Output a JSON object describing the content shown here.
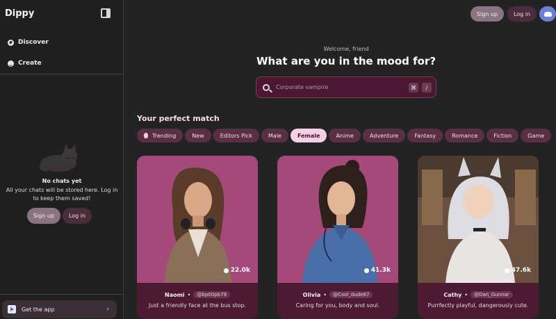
{
  "sidebar": {
    "brand": "Dippy",
    "nav": [
      {
        "label": "Discover",
        "icon": "compass-icon"
      },
      {
        "label": "Create",
        "icon": "smile-icon"
      }
    ],
    "empty_title": "No chats yet",
    "empty_text": "All your chats will be stored here. Log in to keep them saved!",
    "signup_label": "Sign up",
    "login_label": "Log in",
    "get_app_label": "Get the app"
  },
  "header": {
    "signup_label": "Sign up",
    "login_label": "Log in"
  },
  "hero": {
    "welcome": "Welcome, friend",
    "headline": "What are you in the mood for?",
    "search_placeholder": "Corporate vampire",
    "kbd1": "⌘",
    "kbd2": "/"
  },
  "section": {
    "title": "Your perfect match",
    "chips": [
      "Trending",
      "New",
      "Editors Pick",
      "Male",
      "Female",
      "Anime",
      "Adventure",
      "Fantasy",
      "Romance",
      "Fiction",
      "Game"
    ],
    "active_chip": "Female"
  },
  "cards": [
    {
      "name": "Naomi",
      "handle": "@bp00pb79",
      "desc": "Just a friendly face at the bus stop.",
      "count": "22.0k",
      "bg": "#a5497a"
    },
    {
      "name": "Olivia",
      "handle": "@Cool_dude67",
      "desc": "Caring for you, body and soul.",
      "count": "41.3k",
      "bg": "#a5497a"
    },
    {
      "name": "Cathy",
      "handle": "@Dan_Gunnar",
      "desc": "Purrfectly playful, dangerously cute.",
      "count": "47.6k",
      "bg": "#6b5040"
    }
  ],
  "colors": {
    "accent": "#f5cfe3",
    "card_footer": "#4d1a33",
    "chip": "#5a2e43"
  }
}
